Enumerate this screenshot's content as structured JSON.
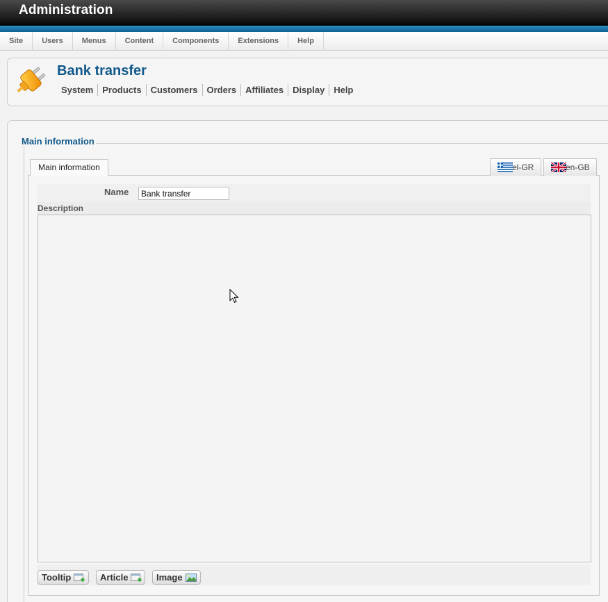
{
  "header": {
    "title": "Administration"
  },
  "main_menu": [
    {
      "label": "Site"
    },
    {
      "label": "Users"
    },
    {
      "label": "Menus"
    },
    {
      "label": "Content"
    },
    {
      "label": "Components"
    },
    {
      "label": "Extensions"
    },
    {
      "label": "Help"
    }
  ],
  "page": {
    "icon": "plug-icon",
    "title": "Bank transfer",
    "submenu": [
      {
        "label": "System"
      },
      {
        "label": "Products"
      },
      {
        "label": "Customers"
      },
      {
        "label": "Orders"
      },
      {
        "label": "Affiliates"
      },
      {
        "label": "Display"
      },
      {
        "label": "Help"
      }
    ]
  },
  "form": {
    "legend": "Main information",
    "tab_label": "Main information",
    "languages": [
      {
        "code": "el-GR",
        "icon": "greek-flag-icon"
      },
      {
        "code": "en-GB",
        "icon": "uk-flag-icon"
      }
    ],
    "name_label": "Name",
    "name_value": "Bank transfer",
    "description_label": "Description",
    "description_value": "",
    "editor_buttons": [
      {
        "label": "Tooltip",
        "icon": "tooltip-insert-icon"
      },
      {
        "label": "Article",
        "icon": "article-insert-icon"
      },
      {
        "label": "Image",
        "icon": "image-insert-icon"
      }
    ]
  },
  "colors": {
    "header_blue": "#10598a",
    "accent_bar": "#1a7ab0",
    "topbar": "#1a1a1a"
  }
}
